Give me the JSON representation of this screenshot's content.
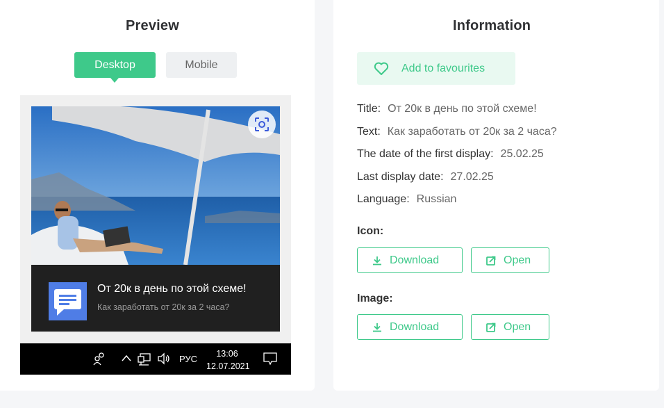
{
  "preview": {
    "title": "Preview",
    "tabs": [
      "Desktop",
      "Mobile"
    ],
    "notification": {
      "title": "От 20к в день по этой схеме!",
      "text": "Как заработать от 20к за 2 часа?"
    },
    "taskbar": {
      "language": "РУС",
      "time": "13:06",
      "date": "12.07.2021"
    }
  },
  "info": {
    "title": "Information",
    "favourites_label": "Add to favourites",
    "fields": [
      {
        "key": "Title:",
        "value": "От 20к в день по этой схеме!"
      },
      {
        "key": "Text:",
        "value": "Как заработать от 20к за 2 часа?"
      },
      {
        "key": "The date of the first display:",
        "value": "25.02.25"
      },
      {
        "key": "Last display date:",
        "value": "27.02.25"
      },
      {
        "key": "Language:",
        "value": "Russian"
      }
    ],
    "icon_section": {
      "label": "Icon:",
      "download": "Download",
      "open": "Open"
    },
    "image_section": {
      "label": "Image:",
      "download": "Download",
      "open": "Open"
    }
  },
  "colors": {
    "accent": "#3ec98a",
    "accent_light": "#e9f9f1",
    "notif_bg": "#202020",
    "app_icon": "#4f7de6"
  }
}
